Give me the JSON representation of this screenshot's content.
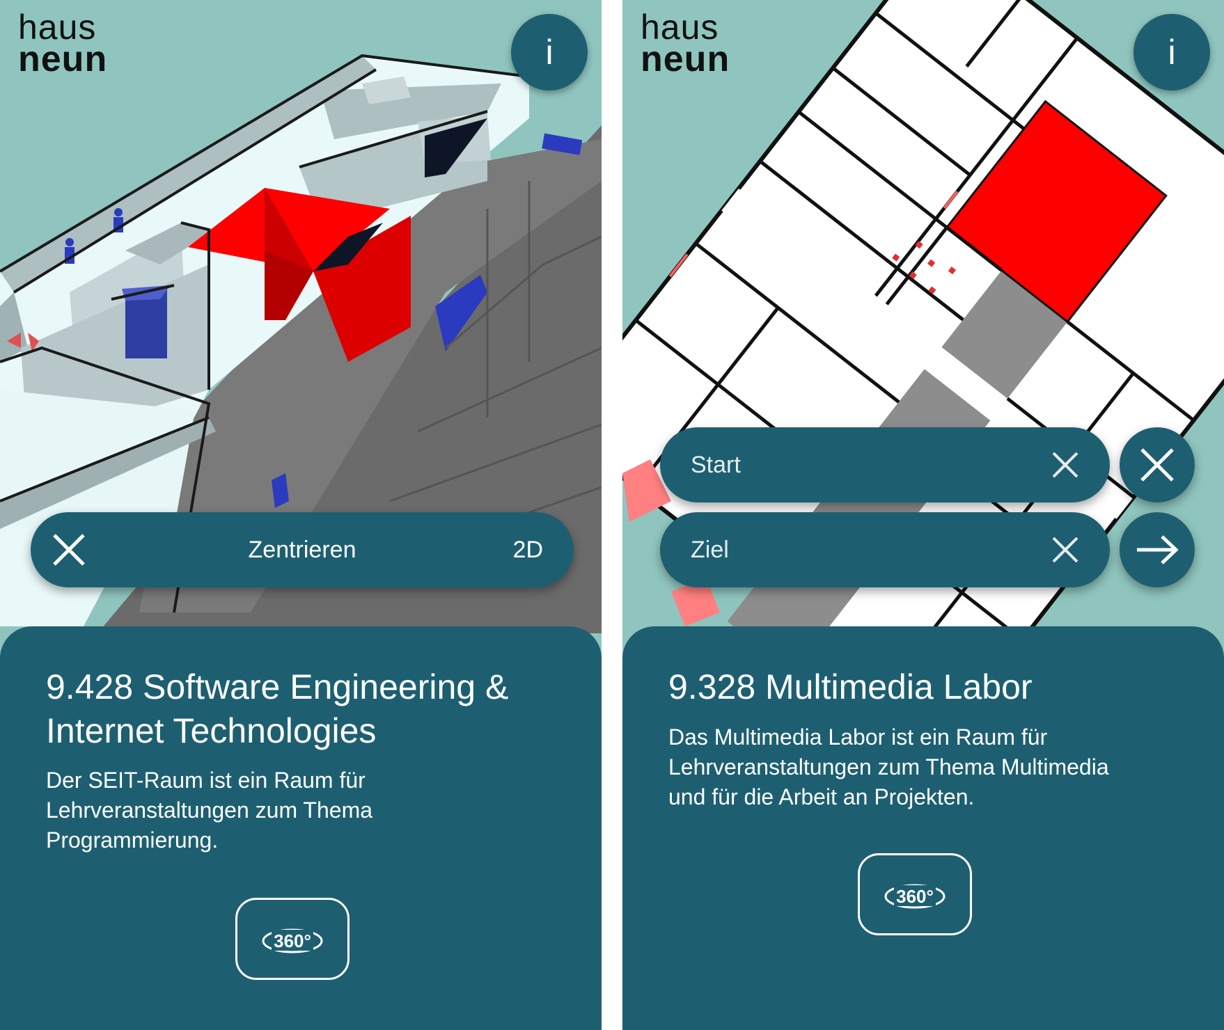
{
  "colors": {
    "background": "#8fc5be",
    "primary": "#1d5f71",
    "highlight_room": "#ff0000",
    "text_on_primary": "#ffffff"
  },
  "left_screen": {
    "logo": {
      "line1": "haus",
      "line2": "neun"
    },
    "info_label": "i",
    "map_view": "3D",
    "toolbar": {
      "close_icon": "close-icon",
      "center_label": "Zentrieren",
      "mode_label": "2D"
    },
    "room": {
      "title_line1": "9.428 Software Engineering &",
      "title_line2": "Internet Technologies",
      "description_lines": [
        "Der SEIT-Raum ist ein Raum für",
        "Lehrveranstaltungen zum Thema",
        "Programmierung."
      ],
      "view360_label": "360°",
      "view360_icon": "panorama-360-icon"
    }
  },
  "right_screen": {
    "logo": {
      "line1": "haus",
      "line2": "neun"
    },
    "info_label": "i",
    "map_view": "2D",
    "route": {
      "start_placeholder": "Start",
      "destination_placeholder": "Ziel",
      "clear_icon": "clear-icon",
      "cancel_icon": "close-icon",
      "go_icon": "arrow-right-icon"
    },
    "room": {
      "title": "9.328 Multimedia Labor",
      "description_lines": [
        "Das Multimedia Labor ist ein Raum für",
        "Lehrveranstaltungen zum Thema Multimedia",
        "und für die Arbeit an Projekten."
      ],
      "view360_label": "360°",
      "view360_icon": "panorama-360-icon"
    }
  }
}
